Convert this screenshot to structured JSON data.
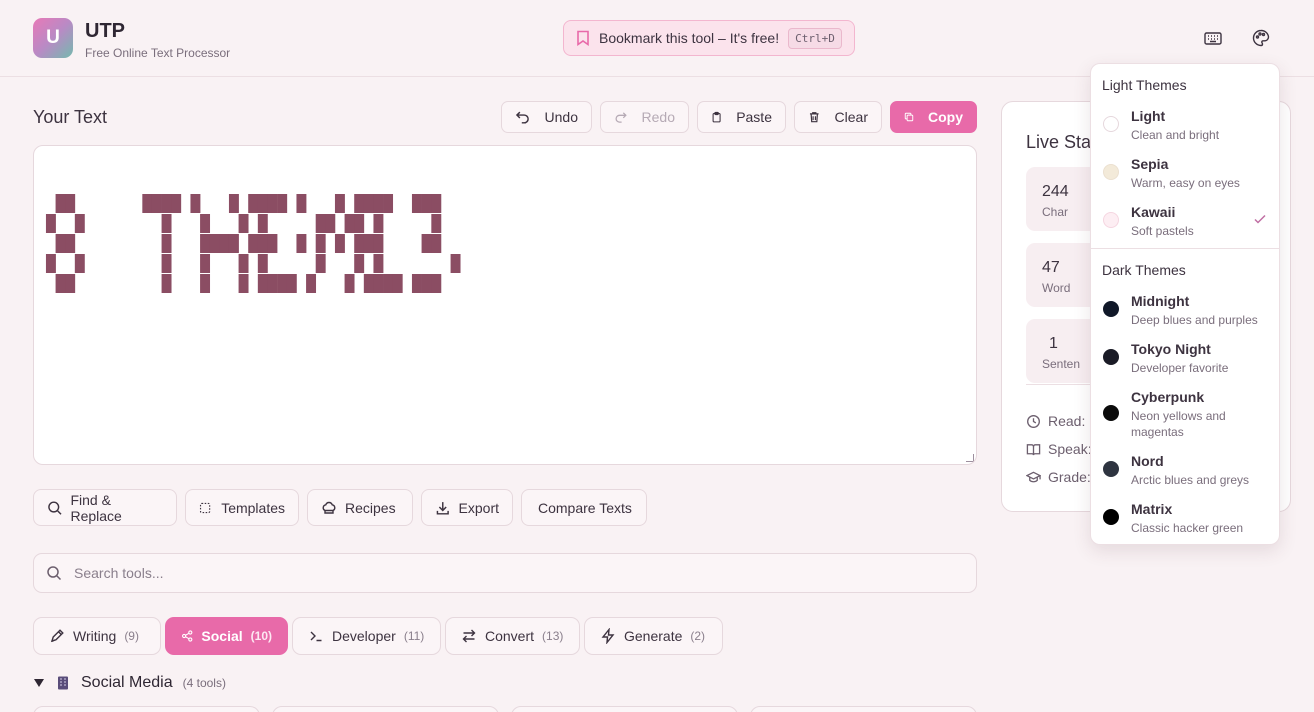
{
  "header": {
    "logo_letter": "U",
    "title": "UTP",
    "subtitle": "Free Online Text Processor",
    "bookmark_text": "Bookmark this tool – It's free!",
    "bookmark_shortcut": "Ctrl+D",
    "icons": [
      "keyboard-icon",
      "palette-icon"
    ]
  },
  "editor": {
    "title": "Your Text",
    "toolbar": {
      "undo": "Undo",
      "redo": "Redo",
      "paste": "Paste",
      "clear": "Clear",
      "copy": "Copy"
    },
    "content": " ██       ████ █   █ ████ █   █ ████  ███\n█  █        █   █   █ █     ██ ██ █     █\n ██         █   ████ ███  █ █ █ ███    ██\n█  █        █   █   █ █     █   █ █       █\n ██         █   █   █ ████ █   █ ████ ███"
  },
  "actions": {
    "find_replace": "Find & Replace",
    "templates": "Templates",
    "recipes": "Recipes",
    "export": "Export",
    "compare": "Compare Texts"
  },
  "search": {
    "placeholder": "Search tools..."
  },
  "categories": [
    {
      "label": "Writing",
      "count": "(9)"
    },
    {
      "label": "Social",
      "count": "(10)"
    },
    {
      "label": "Developer",
      "count": "(11)"
    },
    {
      "label": "Convert",
      "count": "(13)"
    },
    {
      "label": "Generate",
      "count": "(2)"
    }
  ],
  "group": {
    "title": "Social Media",
    "tools": "(4 tools)"
  },
  "stats": {
    "title": "Live Stat",
    "items": [
      {
        "value": "244",
        "label": "Char"
      },
      {
        "value": "47",
        "label": "Word"
      },
      {
        "value": "1",
        "label": "Senten"
      }
    ],
    "meta": [
      "Read:",
      "Speak:",
      "Grade:"
    ]
  },
  "themes": {
    "light_heading": "Light Themes",
    "dark_heading": "Dark Themes",
    "selected": "Kawaii",
    "light": [
      {
        "name": "Light",
        "desc": "Clean and bright",
        "color": "#ffffff"
      },
      {
        "name": "Sepia",
        "desc": "Warm, easy on eyes",
        "color": "#f3ead9"
      },
      {
        "name": "Kawaii",
        "desc": "Soft pastels",
        "color": "#fdeef3"
      }
    ],
    "dark": [
      {
        "name": "Midnight",
        "desc": "Deep blues and purples",
        "color": "#101828"
      },
      {
        "name": "Tokyo Night",
        "desc": "Developer favorite",
        "color": "#1a1b26"
      },
      {
        "name": "Cyberpunk",
        "desc": "Neon yellows and magentas",
        "color": "#0b0b0b"
      },
      {
        "name": "Nord",
        "desc": "Arctic blues and greys",
        "color": "#2e3440"
      },
      {
        "name": "Matrix",
        "desc": "Classic hacker green",
        "color": "#000000"
      }
    ]
  },
  "colors": {
    "accent": "#e86aa9",
    "background": "#f9f2f4"
  }
}
